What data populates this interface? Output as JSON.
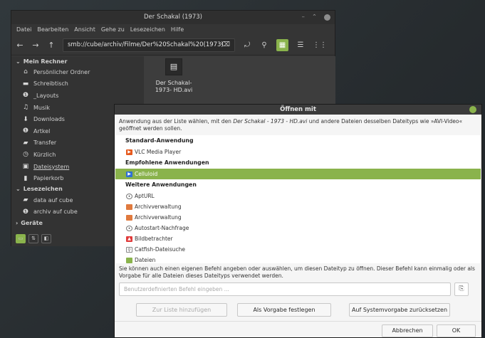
{
  "file_manager": {
    "title": "Der Schakal (1973)",
    "menu": [
      "Datei",
      "Bearbeiten",
      "Ansicht",
      "Gehe zu",
      "Lesezeichen",
      "Hilfe"
    ],
    "location": "smb://cube/archiv/Filme/Der%20Schakal%20(1973)",
    "sidebar": {
      "section_computer": "Mein Rechner",
      "computer_items": [
        {
          "label": "Persönlicher Ordner",
          "icon": "home-icon"
        },
        {
          "label": "Schreibtisch",
          "icon": "desktop-icon"
        },
        {
          "label": "_Layouts",
          "icon": "folder-icon"
        },
        {
          "label": "Musik",
          "icon": "music-icon"
        },
        {
          "label": "Downloads",
          "icon": "download-icon"
        },
        {
          "label": "Artkel",
          "icon": "folder-icon"
        },
        {
          "label": "Transfer",
          "icon": "folder-icon"
        },
        {
          "label": "Kürzlich",
          "icon": "clock-icon"
        },
        {
          "label": "Dateisystem",
          "icon": "drive-icon"
        },
        {
          "label": "Papierkorb",
          "icon": "trash-icon"
        }
      ],
      "section_bookmarks": "Lesezeichen",
      "bookmark_items": [
        {
          "label": "data auf cube",
          "icon": "network-folder-icon"
        },
        {
          "label": "archiv auf cube",
          "icon": "network-folder-icon"
        }
      ],
      "section_devices": "Geräte"
    },
    "file": {
      "name": "Der Schakal-1973- HD.avi",
      "icon": "video-file-icon"
    }
  },
  "dialog": {
    "title": "Öffnen mit",
    "description_pre": "Anwendung aus der Liste wählen, mit den ",
    "description_file": "Der Schakal - 1973 - HD.avi",
    "description_post": " und andere Dateien desselben Dateityps wie »AVI-Video« geöffnet werden sollen.",
    "group_default": "Standard-Anwendung",
    "default_app": "VLC Media Player",
    "group_recommended": "Empfohlene Anwendungen",
    "recommended_app": "Celluloid",
    "group_other": "Weitere Anwendungen",
    "other_apps": [
      "AptURL",
      "Archivverwaltung",
      "Archivverwaltung",
      "Autostart-Nachfrage",
      "Bildbetrachter",
      "Catfish-Dateisuche",
      "Dateien"
    ],
    "hint": "Sie können auch einen eigenen Befehl angeben oder auswählen, um diesen Dateityp zu öffnen. Dieser Befehl kann einmalig oder als Vorgabe für alle Dateien dieses Dateityps verwendet werden.",
    "command_placeholder": "Benutzerdefinierten Befehl eingeben ...",
    "btn_add_list": "Zur Liste hinzufügen",
    "btn_set_default": "Als Vorgabe festlegen",
    "btn_reset_default": "Auf Systemvorgabe zurücksetzen",
    "btn_cancel": "Abbrechen",
    "btn_ok": "OK"
  }
}
